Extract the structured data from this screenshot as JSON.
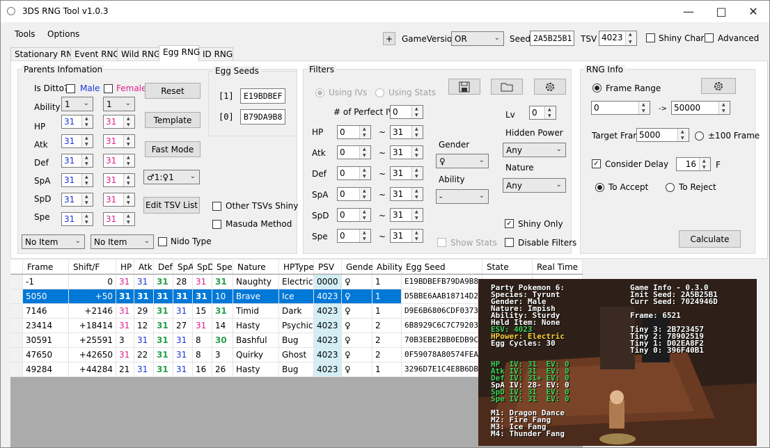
{
  "window": {
    "title": "3DS RNG Tool v1.0.3"
  },
  "menu": [
    "Tools",
    "Options"
  ],
  "toolbar": {
    "plus": "+",
    "game_version_label": "GameVersion",
    "game_version": "OR",
    "seed_label": "Seed",
    "seed": "2A5B25B1",
    "tsv_label": "TSV",
    "tsv": "4023",
    "shiny_charm": "Shiny Charm",
    "advanced": "Advanced"
  },
  "tabs": [
    "Stationary RNG",
    "Event RNG",
    "Wild RNG",
    "Egg RNG",
    "ID RNG"
  ],
  "active_tab": "Egg RNG",
  "parents": {
    "title": "Parents Infomation",
    "is_ditto": "Is Ditto?",
    "male": "Male",
    "female": "Female",
    "ability_label": "Ability",
    "male_ability": "1",
    "female_ability": "1",
    "stats": [
      {
        "label": "HP",
        "male": "31",
        "female": "31"
      },
      {
        "label": "Atk",
        "male": "31",
        "female": "31"
      },
      {
        "label": "Def",
        "male": "31",
        "female": "31"
      },
      {
        "label": "SpA",
        "male": "31",
        "female": "31"
      },
      {
        "label": "SpD",
        "male": "31",
        "female": "31"
      },
      {
        "label": "Spe",
        "male": "31",
        "female": "31"
      }
    ],
    "reset": "Reset",
    "template": "Template",
    "fast_mode": "Fast Mode",
    "gender_ratio": "♂1:♀1",
    "edit_tsv": "Edit TSV List",
    "other_tsvs": "Other TSVs Shiny",
    "masuda": "Masuda Method",
    "male_item": "No Item",
    "female_item": "No Item",
    "nido_type": "Nido Type"
  },
  "egg_seeds": {
    "title": "Egg Seeds",
    "idx1": "[1]",
    "seed1": "E19BDBEF",
    "idx0": "[0]",
    "seed0": "B79DA9B8"
  },
  "filters": {
    "title": "Filters",
    "using_ivs": "Using IVs",
    "using_stats": "Using Stats",
    "perfect_ivs_label": "# of Perfect IVs",
    "perfect_ivs": "0",
    "stats": [
      {
        "label": "HP",
        "min": "0",
        "max": "31"
      },
      {
        "label": "Atk",
        "min": "0",
        "max": "31"
      },
      {
        "label": "Def",
        "min": "0",
        "max": "31"
      },
      {
        "label": "SpA",
        "min": "0",
        "max": "31"
      },
      {
        "label": "SpD",
        "min": "0",
        "max": "31"
      },
      {
        "label": "Spe",
        "min": "0",
        "max": "31"
      }
    ],
    "tilde": "~",
    "gender_label": "Gender",
    "gender": "♀",
    "ability_label": "Ability",
    "ability": "-",
    "lv_label": "Lv",
    "lv": "0",
    "hidden_power_label": "Hidden Power",
    "hidden_power": "Any",
    "nature_label": "Nature",
    "nature": "Any",
    "shiny_only": "Shiny Only",
    "show_stats": "Show Stats",
    "disable_filters": "Disable Filters"
  },
  "rng_info": {
    "title": "RNG Info",
    "frame_range": "Frame Range",
    "range_start": "0",
    "arrow": "->",
    "range_end": "50000",
    "target_frame_label": "Target Frame",
    "target_frame": "5000",
    "pm100": "±100 Frame",
    "consider_delay": "Consider Delay",
    "delay": "16",
    "delay_unit": "F",
    "to_accept": "To Accept",
    "to_reject": "To Reject",
    "calculate": "Calculate"
  },
  "table": {
    "columns": [
      "Frame",
      "Shift/F",
      "HP",
      "Atk",
      "Def",
      "SpA",
      "SpD",
      "Spe",
      "Nature",
      "HPType",
      "PSV",
      "Gender",
      "Ability",
      "Egg Seed",
      "State",
      "Real Time"
    ],
    "rows": [
      [
        "-1",
        "0",
        "31",
        "31",
        "31",
        "28",
        "31",
        "31",
        "Naughty",
        "Electric",
        "0000",
        "♀",
        "1",
        "E19BDBEFB79DA9B8",
        "",
        ""
      ],
      [
        "5050",
        "+50",
        "31",
        "31",
        "31",
        "31",
        "31",
        "10",
        "Brave",
        "Ice",
        "4023",
        "♀",
        "1",
        "D5BBE6AAB18714D2",
        "",
        ""
      ],
      [
        "7146",
        "+2146",
        "31",
        "29",
        "31",
        "31",
        "15",
        "31",
        "Timid",
        "Dark",
        "4023",
        "♀",
        "1",
        "D9E6B6806CDF0373",
        "",
        ""
      ],
      [
        "23414",
        "+18414",
        "31",
        "12",
        "31",
        "27",
        "31",
        "14",
        "Hasty",
        "Psychic",
        "4023",
        "♀",
        "2",
        "6B8929C6C7C79203",
        "",
        ""
      ],
      [
        "30591",
        "+25591",
        "3",
        "31",
        "31",
        "31",
        "8",
        "30",
        "Bashful",
        "Bug",
        "4023",
        "♀",
        "2",
        "70B3EBE2BB0EDB9C",
        "",
        ""
      ],
      [
        "47650",
        "+42650",
        "31",
        "22",
        "31",
        "31",
        "8",
        "3",
        "Quirky",
        "Ghost",
        "4023",
        "♀",
        "2",
        "0F59078A80574FEA",
        "",
        ""
      ],
      [
        "49284",
        "+44284",
        "21",
        "31",
        "31",
        "31",
        "16",
        "26",
        "Hasty",
        "Bug",
        "4023",
        "♀",
        "1",
        "3296D7E1C4E8B6DB",
        "",
        ""
      ]
    ]
  },
  "game": {
    "party_lines": [
      "Party Pokemon 6:",
      "Species: Tyrunt",
      "Gender: Male",
      "Nature: Impish",
      "Ability: Sturdy",
      "Held Item: None",
      "ESV: 4023"
    ],
    "hpower": "HPower: Electric",
    "egg_cycles": "Egg Cycles: 30",
    "info_lines": [
      "Game Info - 0.3.0",
      "Init Seed: 2A5B25B1",
      "Curr Seed: 7024946D"
    ],
    "frame": "Frame: 6521",
    "tiny": [
      "Tiny 3: 2B723457",
      "Tiny 2: 78902519",
      "Tiny 1: D02EA8F2",
      "Tiny 0: 396F40B1"
    ],
    "ivs": [
      "HP  IV: 31  EV: 0",
      "Atk IV: 31  EV: 0",
      "Def IV: 31+ EV: 0",
      "SpA IV: 28- EV: 0",
      "SpD IV: 31  EV: 0",
      "Spe IV: 31  EV: 0"
    ],
    "moves": [
      "M1: Dragon Dance",
      "M2: Fire Fang",
      "M3: Ice Fang",
      "M4: Thunder Fang"
    ]
  }
}
